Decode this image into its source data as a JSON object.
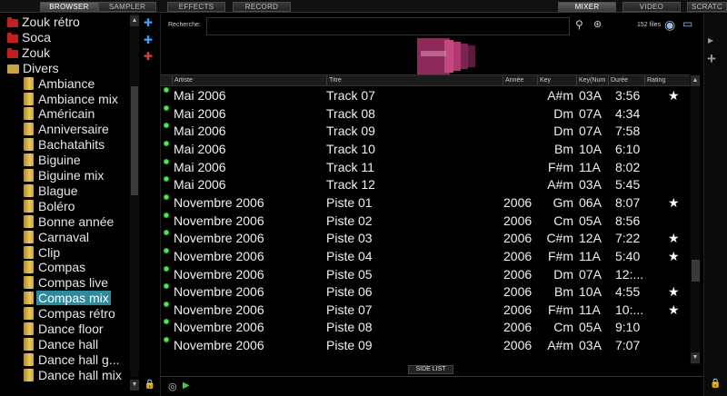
{
  "top_tabs": {
    "browser": "BROWSER",
    "sampler": "SAMPLER",
    "effects": "EFFECTS",
    "record": "RECORD",
    "mixer": "MIXER",
    "video": "VIDEO",
    "scratch": "SCRATC"
  },
  "tree": {
    "items": [
      {
        "label": "Zouk rétro",
        "kind": "red"
      },
      {
        "label": "Soca",
        "kind": "red"
      },
      {
        "label": "Zouk",
        "kind": "red"
      },
      {
        "label": "Divers",
        "kind": "open"
      },
      {
        "label": "Ambiance",
        "kind": "yellow"
      },
      {
        "label": "Ambiance mix",
        "kind": "yellow"
      },
      {
        "label": "Américain",
        "kind": "yellow"
      },
      {
        "label": "Anniversaire",
        "kind": "yellow"
      },
      {
        "label": "Bachatahits",
        "kind": "yellow"
      },
      {
        "label": "Biguine",
        "kind": "yellow"
      },
      {
        "label": "Biguine mix",
        "kind": "yellow"
      },
      {
        "label": "Blague",
        "kind": "yellow"
      },
      {
        "label": "Boléro",
        "kind": "yellow"
      },
      {
        "label": "Bonne année",
        "kind": "yellow"
      },
      {
        "label": "Carnaval",
        "kind": "yellow"
      },
      {
        "label": "Clip",
        "kind": "yellow"
      },
      {
        "label": "Compas",
        "kind": "yellow"
      },
      {
        "label": "Compas live",
        "kind": "yellow"
      },
      {
        "label": "Compas mix",
        "kind": "yellow",
        "selected": true
      },
      {
        "label": "Compas rétro",
        "kind": "yellow"
      },
      {
        "label": "Dance floor",
        "kind": "yellow"
      },
      {
        "label": "Dance hall",
        "kind": "yellow"
      },
      {
        "label": "Dance hall g...",
        "kind": "yellow"
      },
      {
        "label": "Dance hall mix",
        "kind": "yellow"
      }
    ]
  },
  "search": {
    "label": "Recherche:",
    "value": "",
    "file_count": "152 files"
  },
  "columns": {
    "artist": "Artiste",
    "title": "Titre",
    "year": "Année",
    "key": "Key",
    "keynum": "Key(Num",
    "duration": "Durée",
    "rating": "Rating"
  },
  "tracks": [
    {
      "artist": "Mai 2006",
      "title": "Track 07",
      "year": "",
      "key": "A#m",
      "keynum": "03A",
      "duration": "3:56",
      "rating": "★"
    },
    {
      "artist": "Mai 2006",
      "title": "Track 08",
      "year": "",
      "key": "Dm",
      "keynum": "07A",
      "duration": "4:34",
      "rating": ""
    },
    {
      "artist": "Mai 2006",
      "title": "Track 09",
      "year": "",
      "key": "Dm",
      "keynum": "07A",
      "duration": "7:58",
      "rating": ""
    },
    {
      "artist": "Mai 2006",
      "title": "Track 10",
      "year": "",
      "key": "Bm",
      "keynum": "10A",
      "duration": "6:10",
      "rating": ""
    },
    {
      "artist": "Mai 2006",
      "title": "Track 11",
      "year": "",
      "key": "F#m",
      "keynum": "11A",
      "duration": "8:02",
      "rating": ""
    },
    {
      "artist": "Mai 2006",
      "title": "Track 12",
      "year": "",
      "key": "A#m",
      "keynum": "03A",
      "duration": "5:45",
      "rating": ""
    },
    {
      "artist": "Novembre 2006",
      "title": "Piste 01",
      "year": "2006",
      "key": "Gm",
      "keynum": "06A",
      "duration": "8:07",
      "rating": "★"
    },
    {
      "artist": "Novembre 2006",
      "title": "Piste 02",
      "year": "2006",
      "key": "Cm",
      "keynum": "05A",
      "duration": "8:56",
      "rating": ""
    },
    {
      "artist": "Novembre 2006",
      "title": "Piste 03",
      "year": "2006",
      "key": "C#m",
      "keynum": "12A",
      "duration": "7:22",
      "rating": "★"
    },
    {
      "artist": "Novembre 2006",
      "title": "Piste 04",
      "year": "2006",
      "key": "F#m",
      "keynum": "11A",
      "duration": "5:40",
      "rating": "★"
    },
    {
      "artist": "Novembre 2006",
      "title": "Piste 05",
      "year": "2006",
      "key": "Dm",
      "keynum": "07A",
      "duration": "12:...",
      "rating": ""
    },
    {
      "artist": "Novembre 2006",
      "title": "Piste 06",
      "year": "2006",
      "key": "Bm",
      "keynum": "10A",
      "duration": "4:55",
      "rating": "★"
    },
    {
      "artist": "Novembre 2006",
      "title": "Piste 07",
      "year": "2006",
      "key": "F#m",
      "keynum": "11A",
      "duration": "10:...",
      "rating": "★"
    },
    {
      "artist": "Novembre 2006",
      "title": "Piste 08",
      "year": "2006",
      "key": "Cm",
      "keynum": "05A",
      "duration": "9:10",
      "rating": ""
    },
    {
      "artist": "Novembre 2006",
      "title": "Piste 09",
      "year": "2006",
      "key": "A#m",
      "keynum": "03A",
      "duration": "7:07",
      "rating": ""
    }
  ],
  "side_list": "SIDE LIST",
  "colors": {
    "accent": "#2d8a9b",
    "status_dot": "#3fcf3f",
    "folder_red": "#c31f1f",
    "folder_yellow": "#e8c660"
  }
}
